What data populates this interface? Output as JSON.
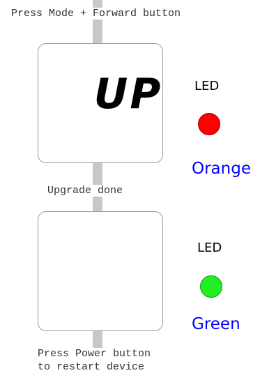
{
  "top_instruction": "Press Mode + Forward button",
  "display_text": "UP",
  "middle_status": "Upgrade done",
  "bottom_instruction": [
    "Press Power button",
    "to restart device"
  ],
  "led1": {
    "label": "LED",
    "color_name": "Orange",
    "led_color": "#ff0000",
    "text_color": "#0000ff"
  },
  "led2": {
    "label": "LED",
    "color_name": "Green",
    "led_color": "#22ee22",
    "text_color": "#0000ff"
  }
}
